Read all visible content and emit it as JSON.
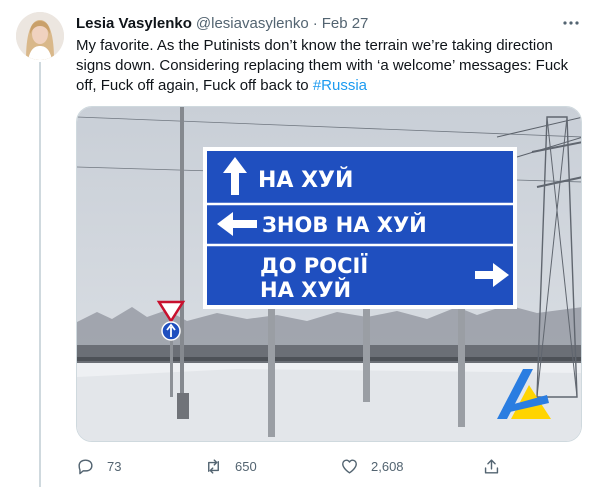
{
  "tweet": {
    "display_name": "Lesia Vasylenko",
    "handle": "@lesiavasylenko",
    "separator": "·",
    "date": "Feb 27",
    "text_before_hashtag": "My favorite. As the Putinists don’t know the terrain we’re taking direction signs down. Considering replacing them with ‘a welcome’ messages: Fuck off, Fuck off again, Fuck off back to ",
    "hashtag": "#Russia",
    "media_sign": {
      "line1": "НА ХУЙ",
      "line2": "ЗНОВ НА ХУЙ",
      "line3a": "ДО РОСІЇ",
      "line3b": "НА ХУЙ",
      "arrow_up_icon": "arrow-up-icon",
      "arrow_left_icon": "arrow-left-icon",
      "arrow_right_icon": "arrow-right-icon"
    },
    "actions": {
      "reply_count": "73",
      "retweet_count": "650",
      "like_count": "2,608"
    }
  },
  "icons": {
    "more": "more-horizontal-icon",
    "reply": "reply-icon",
    "retweet": "retweet-icon",
    "like": "heart-icon",
    "share": "share-icon"
  },
  "colors": {
    "text": "#0f1419",
    "secondary": "#536471",
    "link": "#1d9bf0",
    "sign_blue": "#1f4fbf",
    "border": "#cfd9de"
  }
}
